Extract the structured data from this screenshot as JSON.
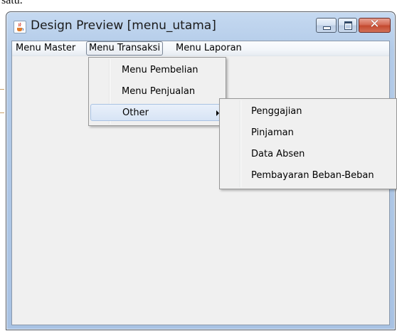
{
  "background": {
    "text": "satu."
  },
  "window": {
    "title": "Design Preview [menu_utama]",
    "icon": "java-cup-icon",
    "buttons": {
      "minimize": "minimize-icon",
      "maximize": "maximize-icon",
      "close": "close-icon"
    },
    "close_glyph": "✕"
  },
  "menubar": {
    "items": [
      {
        "label": "Menu Master"
      },
      {
        "label": "Menu Transaksi"
      },
      {
        "label": "Menu Laporan"
      }
    ]
  },
  "transaksi_menu": {
    "items": [
      {
        "label": "Menu Pembelian"
      },
      {
        "label": "Menu Penjualan"
      },
      {
        "label": "Other"
      }
    ]
  },
  "other_submenu": {
    "items": [
      {
        "label": "Penggajian"
      },
      {
        "label": "Pinjaman"
      },
      {
        "label": "Data Absen"
      },
      {
        "label": "Pembayaran Beban-Beban"
      }
    ]
  },
  "colors": {
    "close_button": "#c44a2f",
    "frame": "#b3cbe8",
    "menu_hover": "#d7e4f5"
  }
}
